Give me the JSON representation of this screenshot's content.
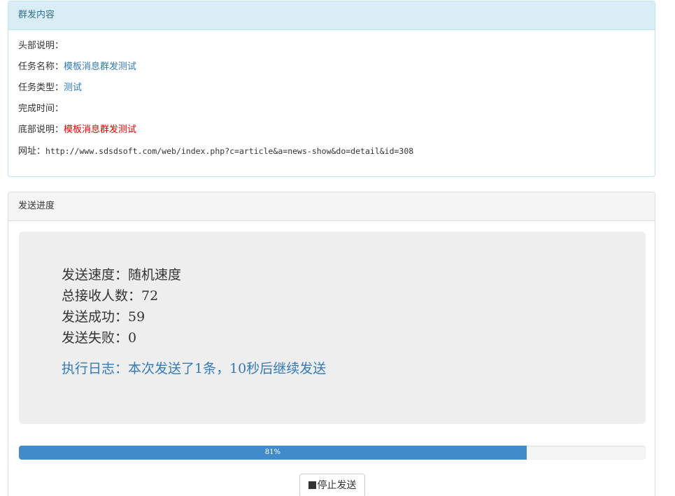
{
  "info_panel": {
    "title": "群发内容",
    "header_desc": {
      "label": "头部说明：",
      "value": ""
    },
    "task_name": {
      "label": "任务名称：",
      "value": "模板消息群发测试"
    },
    "task_type": {
      "label": "任务类型：",
      "value": "测试"
    },
    "finish_time": {
      "label": "完成时间：",
      "value": ""
    },
    "footer_desc": {
      "label": "底部说明：",
      "value": "模板消息群发测试"
    },
    "url": {
      "label": "网址：",
      "value": "http://www.sdsdsoft.com/web/index.php?c=article&a=news-show&do=detail&id=308"
    }
  },
  "progress_panel": {
    "title": "发送进度",
    "speed": "发送速度：随机速度",
    "total_receivers": "总接收人数：72",
    "success": "发送成功：59",
    "failed": "发送失败：0",
    "log": "执行日志：本次发送了1条，10秒后继续发送",
    "progress": {
      "percent": 81,
      "label": "81%"
    },
    "stop_button": "停止发送"
  },
  "colors": {
    "info_heading_bg": "#d9edf7",
    "info_heading_text": "#31708f",
    "link_blue": "#337ab7",
    "warn_red": "#e00000",
    "progress_fill": "#428bca"
  },
  "icons": {
    "stop": "stop-icon"
  }
}
